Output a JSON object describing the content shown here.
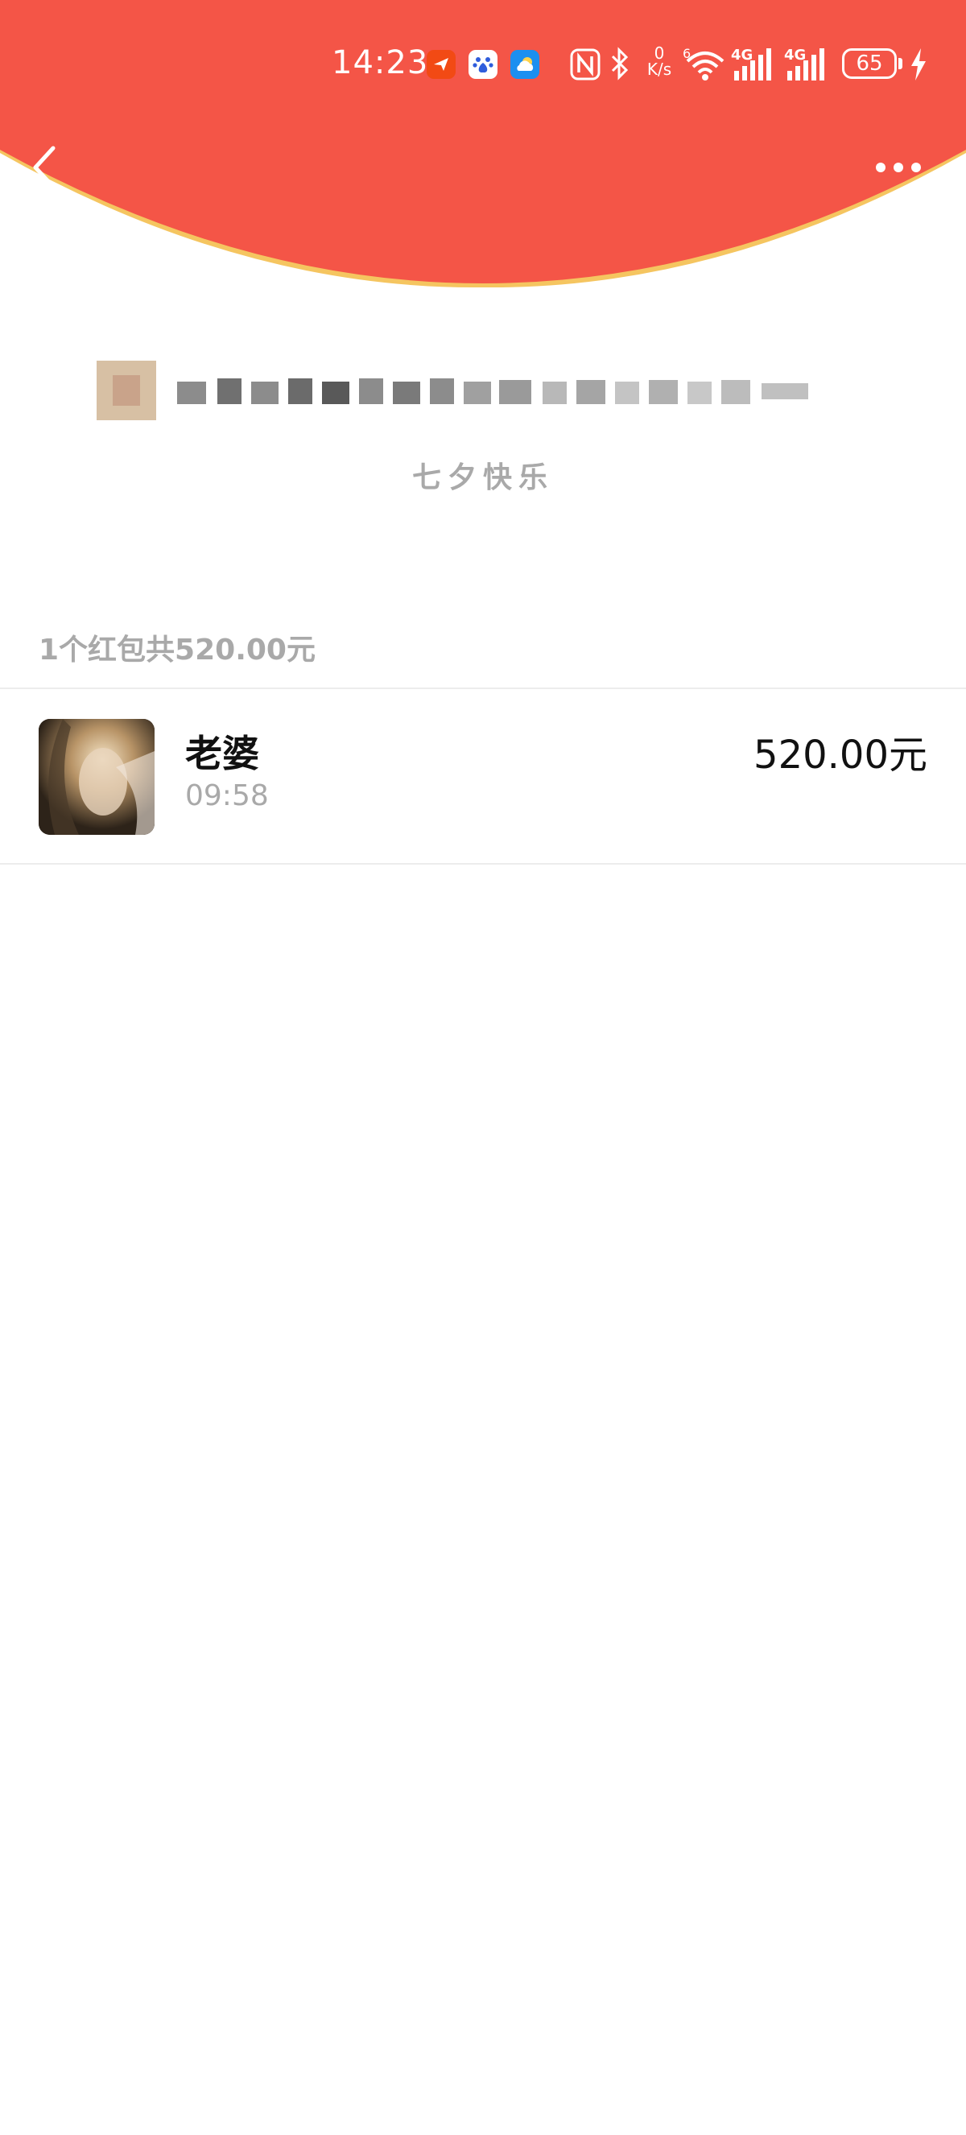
{
  "colors": {
    "header_red": "#f45547",
    "gold_rim": "#f5c560",
    "muted_text": "#a9a9a9"
  },
  "status_bar": {
    "time": "14:23",
    "app_icons": [
      "messenger-app-icon",
      "baidu-app-icon",
      "weather-app-icon"
    ],
    "indicators": [
      "nfc-icon",
      "bluetooth-icon"
    ],
    "net_speed_value": "0",
    "net_speed_unit": "K/s",
    "wifi_label": "6",
    "signal_label_1": "4G",
    "signal_label_2": "4G",
    "battery": "65"
  },
  "nav": {
    "back_icon": "chevron-left-icon",
    "more_icon": "more-horizontal-icon"
  },
  "sender": {
    "greeting": "七夕快乐"
  },
  "summary": {
    "text": "1个红包共520.00元"
  },
  "recipients": [
    {
      "name": "老婆",
      "time": "09:58",
      "amount": "520.00元"
    }
  ]
}
